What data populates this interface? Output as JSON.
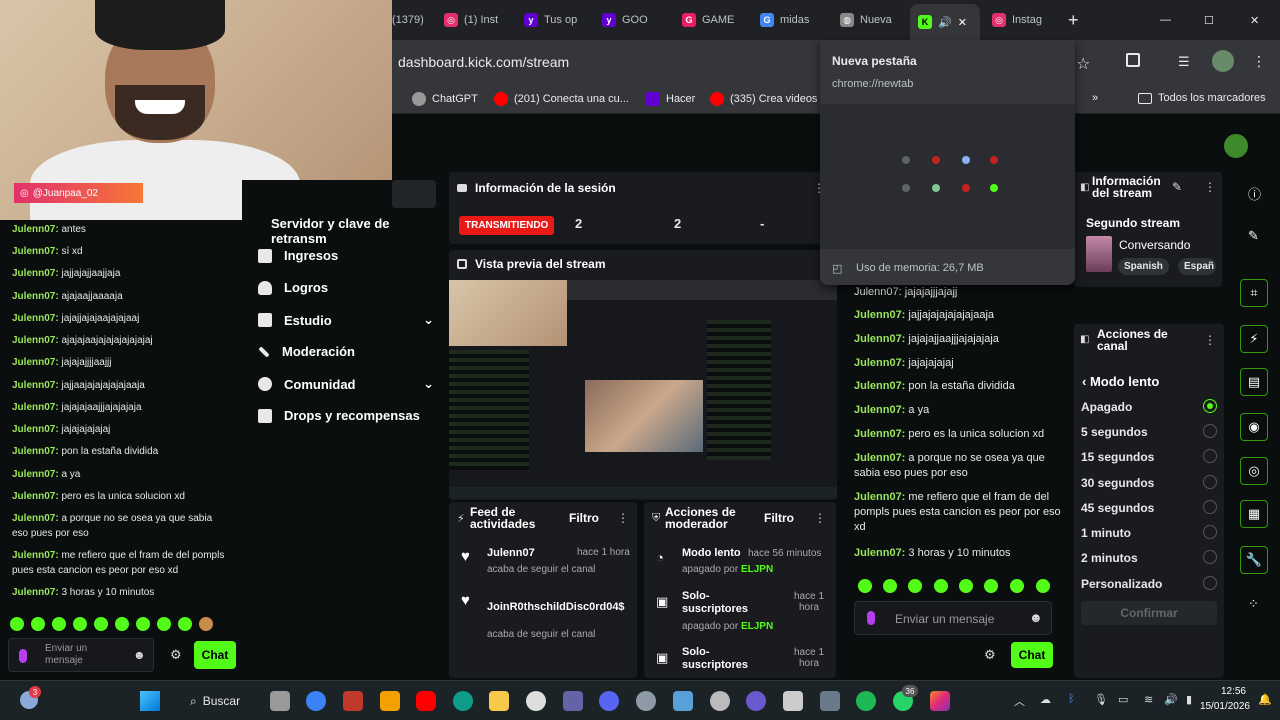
{
  "browser": {
    "tabs": [
      {
        "label": "(1379)",
        "icon": "youtube-icon",
        "color": "#ff0000"
      },
      {
        "label": "(1) Inst",
        "icon": "instagram-icon",
        "color": "#e1306c"
      },
      {
        "label": "Tus op",
        "icon": "yahoo-icon",
        "color": "#6001d2"
      },
      {
        "label": "GOO",
        "icon": "yahoo-icon",
        "color": "#6001d2"
      },
      {
        "label": "GAME",
        "icon": "g-icon",
        "color": "#e91e63"
      },
      {
        "label": "midas",
        "icon": "google-icon",
        "color": "#4285f4"
      },
      {
        "label": "Nueva",
        "icon": "globe-icon",
        "color": "#888888"
      },
      {
        "label": "K",
        "icon": "kick-icon",
        "color": "#53fc18"
      },
      {
        "label": "Instag",
        "icon": "instagram-icon",
        "color": "#e1306c"
      }
    ],
    "url": "dashboard.kick.com/stream",
    "bookmarks": [
      "ChatGPT",
      "(201) Conecta una cu...",
      "Hacer",
      "(335) Crea videos"
    ],
    "bookmarks_all": "Todos los marcadores"
  },
  "tab_popup": {
    "title": "Nueva pestaña",
    "url": "chrome://newtab",
    "memory": "Uso de memoria: 26,7 MB"
  },
  "webcam": {
    "handle": "@Juanpaa_02"
  },
  "chat_left": {
    "messages": [
      {
        "user": "Julenn07:",
        "text": "antes"
      },
      {
        "user": "Julenn07:",
        "text": "sí xd"
      },
      {
        "user": "Julenn07:",
        "text": "jajjajajjaajjaja"
      },
      {
        "user": "Julenn07:",
        "text": "ajajaajjaaaaja"
      },
      {
        "user": "Julenn07:",
        "text": "jajajjajajaajajajaaj"
      },
      {
        "user": "Julenn07:",
        "text": "ajajajaajajajajajajajaj"
      },
      {
        "user": "Julenn07:",
        "text": "jajajajjjjaajjj"
      },
      {
        "user": "Julenn07:",
        "text": "jajjaajajajajajajaaja"
      },
      {
        "user": "Julenn07:",
        "text": "jajajajaajjjajajajaja"
      },
      {
        "user": "Julenn07:",
        "text": "jajajajajajaj"
      },
      {
        "user": "Julenn07:",
        "text": "pon la estaña dividida"
      },
      {
        "user": "Julenn07:",
        "text": "a ya"
      },
      {
        "user": "Julenn07:",
        "text": "pero es la unica solucion xd"
      },
      {
        "user": "Julenn07:",
        "text": "a porque no se osea ya que sabia eso pues por eso"
      },
      {
        "user": "Julenn07:",
        "text": "me refiero que el fram de del pompls pues esta cancion es peor por eso xd"
      },
      {
        "user": "Julenn07:",
        "text": "3 horas y 10 minutos"
      }
    ],
    "input_placeholder": "Enviar un mensaje",
    "send": "Chat"
  },
  "nav": {
    "partial": "Servidor y clave de retransm",
    "items": [
      "Ingresos",
      "Logros",
      "Estudio",
      "Moderación",
      "Comunidad",
      "Drops y recompensas"
    ]
  },
  "session": {
    "title": "Información de la sesión",
    "status": "TRANSMITIENDO",
    "stats": [
      "2",
      "2",
      "-"
    ]
  },
  "preview": {
    "title": "Vista previa del stream"
  },
  "activity": {
    "title": "Feed de actividades",
    "filter": "Filtro",
    "items": [
      {
        "user": "Julenn07",
        "time": "hace 1 hora",
        "text": "acaba de seguir el canal"
      },
      {
        "user": "JoinR0thschildDisc0rd04$",
        "time": "",
        "text": "acaba de seguir el canal"
      }
    ]
  },
  "modactions": {
    "title": "Acciones de moderador",
    "filter": "Filtro",
    "items": [
      {
        "title": "Modo lento",
        "time": "hace 56 minutos",
        "detail": "apagado por",
        "by": "ELJPN"
      },
      {
        "title": "Solo-suscriptores",
        "time": "hace 1 hora",
        "detail": "apagado por",
        "by": "ELJPN"
      },
      {
        "title": "Solo-suscriptores",
        "time": "hace 1 hora",
        "detail": "",
        "by": ""
      }
    ]
  },
  "chat_main": {
    "partial": "Julenn07: jajajajjjajajj",
    "messages": [
      {
        "user": "Julenn07:",
        "text": "jajjajajajajajajaaja"
      },
      {
        "user": "Julenn07:",
        "text": "jajajajjaajjjajajajaja"
      },
      {
        "user": "Julenn07:",
        "text": "jajajajajaj"
      },
      {
        "user": "Julenn07:",
        "text": "pon la estaña dividida"
      },
      {
        "user": "Julenn07:",
        "text": "a ya"
      },
      {
        "user": "Julenn07:",
        "text": "pero es la unica solucion xd"
      },
      {
        "user": "Julenn07:",
        "text": "a porque no se osea ya que sabia eso pues por eso"
      },
      {
        "user": "Julenn07:",
        "text": "me refiero que el fram de del pompls pues esta cancion es peor por eso xd"
      },
      {
        "user": "Julenn07:",
        "text": "3 horas y 10 minutos"
      }
    ],
    "input_placeholder": "Enviar un mensaje",
    "send": "Chat"
  },
  "stream_info": {
    "title": "Información del stream",
    "name": "Segundo stream",
    "category": "Conversando",
    "tags": [
      "Spanish",
      "Españ"
    ]
  },
  "channel_actions": {
    "title": "Acciones de canal",
    "back": "Modo lento",
    "options": [
      "Apagado",
      "5 segundos",
      "15 segundos",
      "30 segundos",
      "45 segundos",
      "1 minuto",
      "2 minutos",
      "Personalizado"
    ],
    "selected": "Apagado",
    "confirm": "Confirmar"
  },
  "taskbar": {
    "search": "Buscar",
    "time": "12:56",
    "date": "15/01/2026",
    "weather_badge": "3",
    "whatsapp_badge": "36"
  },
  "colors": {
    "accent": "#53fc18",
    "live": "#e91916",
    "bg": "#0b0e0f"
  }
}
